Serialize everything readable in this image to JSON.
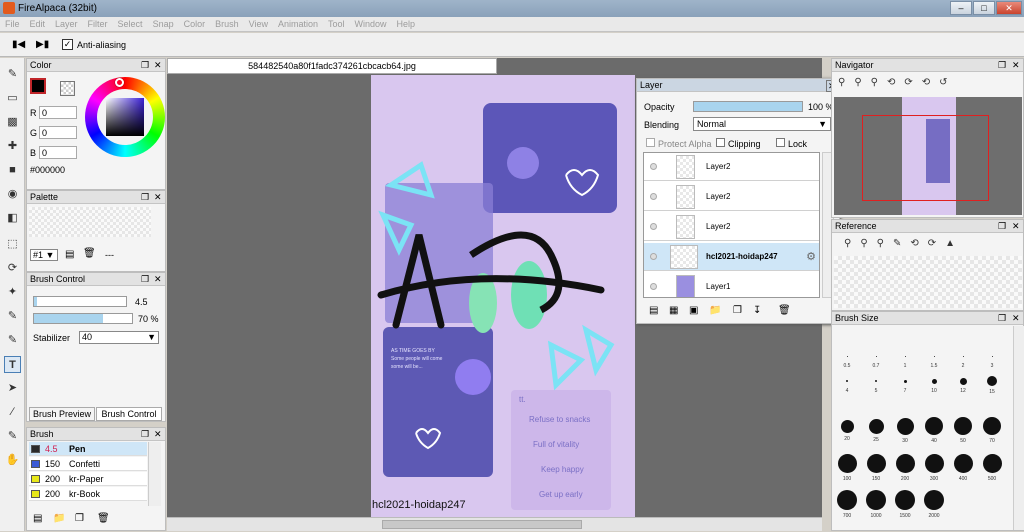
{
  "app": {
    "title": "FireAlpaca (32bit)",
    "min": "–",
    "max": "□",
    "close": "✕"
  },
  "menu": [
    "File",
    "Edit",
    "Layer",
    "Filter",
    "Select",
    "Snap",
    "Color",
    "Brush",
    "View",
    "Animation",
    "Tool",
    "Window",
    "Help"
  ],
  "toolopts": {
    "antialias_label": "Anti-aliasing"
  },
  "color": {
    "title": "Color",
    "r_label": "R",
    "g_label": "G",
    "b_label": "B",
    "r": "0",
    "g": "0",
    "b": "0",
    "hex": "#000000",
    "primary": "#000000"
  },
  "palette": {
    "title": "Palette",
    "select": "#1",
    "more": "---"
  },
  "brush_control": {
    "title": "Brush Control",
    "size": "4.5",
    "opacity": "70 %",
    "opacity_frac": 0.7,
    "size_frac": 0.03,
    "stabilizer_label": "Stabilizer",
    "stabilizer": "40"
  },
  "brush_tabs": {
    "preview": "Brush Preview",
    "control": "Brush Control"
  },
  "brush": {
    "title": "Brush",
    "items": [
      {
        "size": "4.5",
        "name": "Pen",
        "color": "#2a2a2a"
      },
      {
        "size": "150",
        "name": "Confetti",
        "color": "#3b5bd6"
      },
      {
        "size": "200",
        "name": "kr-Paper",
        "color": "#e8e81a"
      },
      {
        "size": "200",
        "name": "kr-Book",
        "color": "#e8e81a"
      }
    ]
  },
  "document": {
    "tab": "584482540a80f1fadc374261cbcacb64.jpg",
    "caption": "hcl2021-hoidap247",
    "card_lines": [
      "AS TIME GOES BY",
      "Some people will come",
      "some will be..."
    ],
    "list": [
      "Refuse to snacks",
      "Full of vitality",
      "Keep happy",
      "Get up early"
    ],
    "list_head": "tt."
  },
  "layer": {
    "title": "Layer",
    "opacity_label": "Opacity",
    "opacity": "100 %",
    "blending_label": "Blending",
    "blending": "Normal",
    "protect_alpha": "Protect Alpha",
    "clipping": "Clipping",
    "lock": "Lock",
    "layers": [
      {
        "name": "Layer2"
      },
      {
        "name": "Layer2"
      },
      {
        "name": "Layer2"
      },
      {
        "name": "hcl2021-hoidap247"
      },
      {
        "name": "Layer1"
      }
    ]
  },
  "navigator": {
    "title": "Navigator"
  },
  "reference": {
    "title": "Reference"
  },
  "brush_size": {
    "title": "Brush Size",
    "labels": [
      "0.5",
      "0.7",
      "1",
      "1.5",
      "2",
      "3",
      "4",
      "5",
      "7",
      "10",
      "12",
      "15",
      "20",
      "25",
      "30",
      "40",
      "50",
      "70",
      "100",
      "150",
      "200",
      "300",
      "400",
      "500",
      "700",
      "1000",
      "1500",
      "2000"
    ]
  }
}
